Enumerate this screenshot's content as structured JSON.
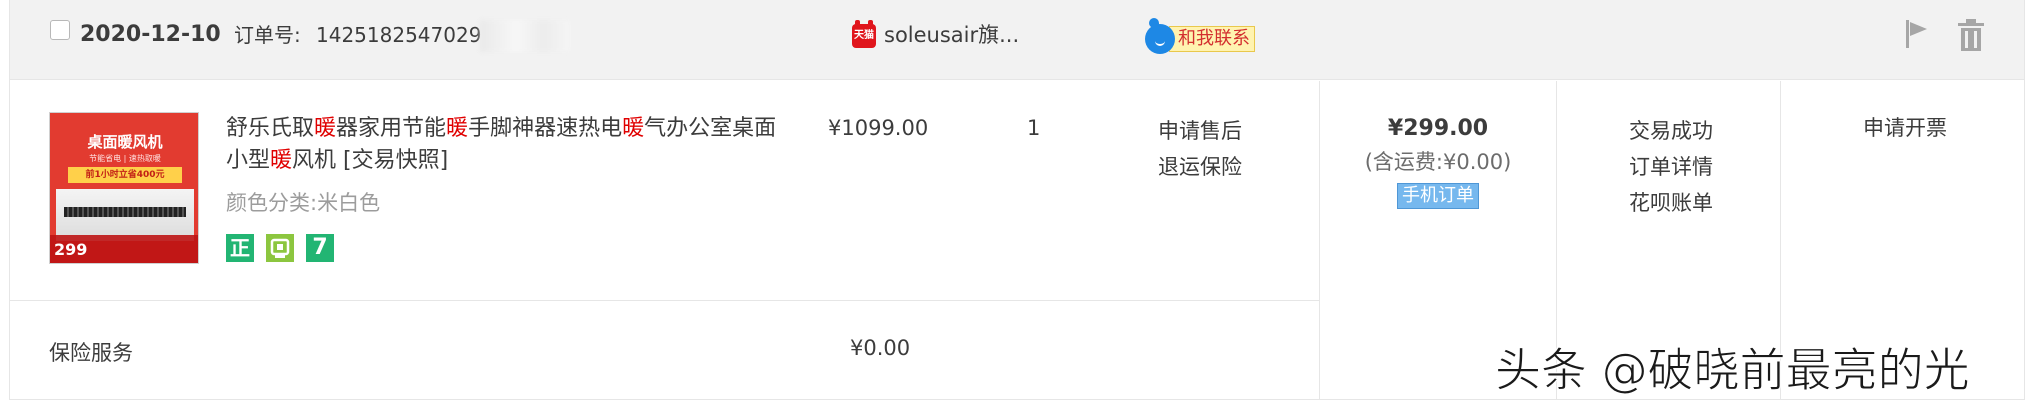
{
  "header": {
    "date": "2020-12-10",
    "order_no_label": "订单号:",
    "order_no": "1425182547029",
    "tmall_icon_text": "天猫",
    "shop_name": "soleusair旗...",
    "contact_label": "和我联系"
  },
  "item": {
    "title_parts": [
      "舒乐氏取",
      "暖",
      "器家用节能",
      "暖",
      "手脚神器速热电",
      "暖",
      "气办公室桌面小型",
      "暖",
      "风机 [交易快照]"
    ],
    "color_spec": "颜色分类:米白色",
    "badges": [
      "正",
      "保",
      "7"
    ],
    "image": {
      "title": "桌面暖风机",
      "subtitle": "节能省电 | 速热取暖",
      "promo": "前1小时立省400元",
      "price": "299"
    },
    "unit_price": "¥1099.00",
    "quantity": "1",
    "aftersale": [
      "申请售后",
      "退运保险"
    ]
  },
  "total": {
    "price": "¥299.00",
    "shipping": "(含运费:¥0.00)",
    "tag": "手机订单"
  },
  "status": {
    "items": [
      "交易成功",
      "订单详情",
      "花呗账单"
    ]
  },
  "invoice": {
    "label": "申请开票"
  },
  "insurance": {
    "label": "保险服务",
    "price": "¥0.00"
  },
  "watermark": "头条 @破晓前最亮的光",
  "colors": {
    "header_bg": "#f2f2f2",
    "border": "#e6e6e6",
    "highlight_red": "#e00000",
    "badge_green": "#22b573",
    "mobile_tag_blue": "#76b8ee"
  }
}
